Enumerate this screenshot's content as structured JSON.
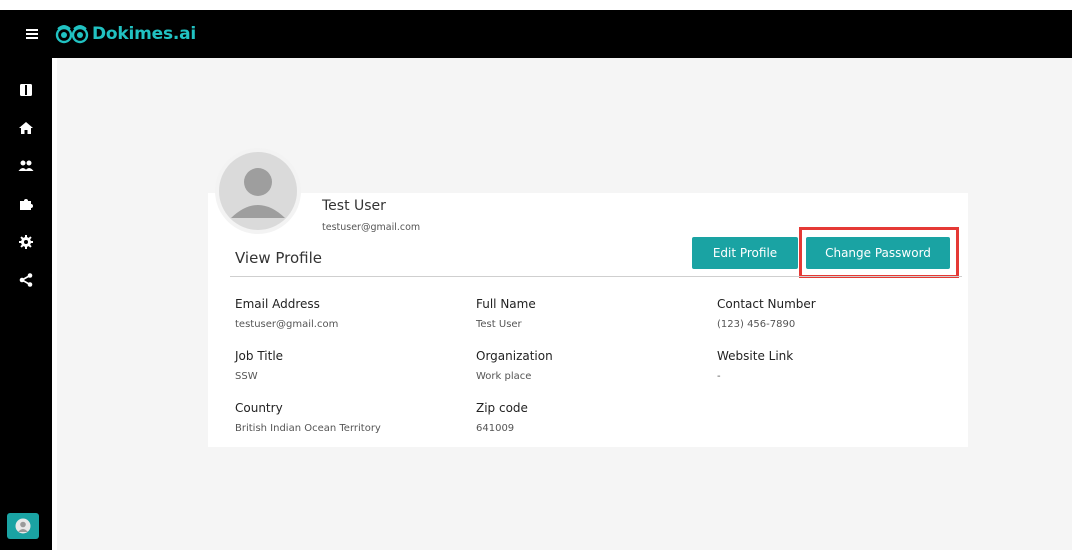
{
  "app": {
    "brand": "Dokimes.ai",
    "brand_color": "#21c2c2",
    "accent_color": "#1aa3a3",
    "highlight_color": "#e53935"
  },
  "sidebar": {
    "items": [
      {
        "name": "book-icon"
      },
      {
        "name": "home-icon"
      },
      {
        "name": "users-icon"
      },
      {
        "name": "puzzle-icon"
      },
      {
        "name": "gear-icon"
      },
      {
        "name": "share-icon"
      }
    ]
  },
  "profile": {
    "name": "Test User",
    "email": "testuser@gmail.com",
    "section_title": "View Profile",
    "edit_label": "Edit Profile",
    "change_password_label": "Change Password",
    "fields": [
      {
        "label": "Email Address",
        "value": "testuser@gmail.com"
      },
      {
        "label": "Full Name",
        "value": "Test User"
      },
      {
        "label": "Contact Number",
        "value": "(123) 456-7890"
      },
      {
        "label": "Job Title",
        "value": "SSW"
      },
      {
        "label": "Organization",
        "value": "Work place"
      },
      {
        "label": "Website Link",
        "value": "-"
      },
      {
        "label": "Country",
        "value": "British Indian Ocean Territory"
      },
      {
        "label": "Zip code",
        "value": "641009"
      }
    ]
  }
}
